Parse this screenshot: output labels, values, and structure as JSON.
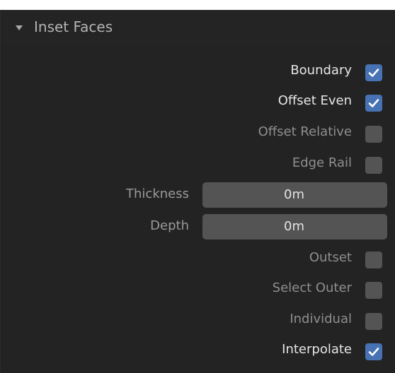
{
  "panel": {
    "title": "Inset Faces",
    "options": [
      {
        "label": "Boundary",
        "checked": true,
        "enabled": true
      },
      {
        "label": "Offset Even",
        "checked": true,
        "enabled": true
      },
      {
        "label": "Offset Relative",
        "checked": false,
        "enabled": false
      },
      {
        "label": "Edge Rail",
        "checked": false,
        "enabled": false
      }
    ],
    "fields": [
      {
        "label": "Thickness",
        "value": "0m"
      },
      {
        "label": "Depth",
        "value": "0m"
      }
    ],
    "options2": [
      {
        "label": "Outset",
        "checked": false,
        "enabled": false
      },
      {
        "label": "Select Outer",
        "checked": false,
        "enabled": false
      },
      {
        "label": "Individual",
        "checked": false,
        "enabled": false
      },
      {
        "label": "Interpolate",
        "checked": true,
        "enabled": true
      }
    ]
  },
  "colors": {
    "panel_bg": "#232323",
    "checkbox_on": "#4772b3",
    "checkbox_off": "#545454",
    "field_bg": "#545454",
    "text_on": "#e6e6e6",
    "text_off": "#8f8f8f"
  },
  "icons": {
    "collapse": "triangle-down-icon",
    "check": "checkmark-icon"
  }
}
